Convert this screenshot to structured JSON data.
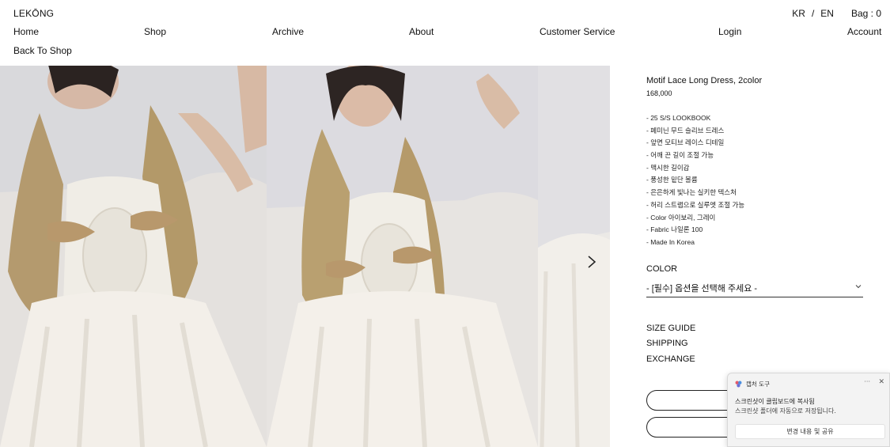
{
  "header": {
    "brand": "LEKŌNG",
    "lang_kr": "KR",
    "lang_sep": "/",
    "lang_en": "EN",
    "bag": "Bag : 0"
  },
  "nav": {
    "items": [
      "Home",
      "Shop",
      "Archive",
      "About",
      "Customer Service",
      "Login",
      "Account"
    ]
  },
  "back_link": "Back To Shop",
  "gallery": {
    "next_icon": "chevron-right-icon"
  },
  "product": {
    "title": "Motif Lace Long Dress, 2color",
    "price": "168,000",
    "description": [
      "- 25 S/S LOOKBOOK",
      "- 페미닌 무드 슬리브 드레스",
      "- 앞면 모티브 레이스 디테일",
      "- 어깨 끈 길이 조절 가능",
      "- 맥시한 길이감",
      "- 풍성한 밑단 볼륨",
      "- 은은하게 빛나는 실키한 텍스처",
      "- 허리 스트랩으로 실루엣 조절 가능",
      "- Color 아이보리, 그레이",
      "- Fabric 나일론 100",
      "- Made In Korea"
    ],
    "color_label": "COLOR",
    "color_select": "- [필수] 옵션을 선택해 주세요 -",
    "links": [
      "SIZE GUIDE",
      "SHIPPING",
      "EXCHANGE"
    ]
  },
  "toast": {
    "app_name": "캡처 도구",
    "more": "···",
    "close": "✕",
    "title": "스크린샷이 클립보드에 복사됨",
    "subtitle": "스크린샷 폴더에 자동으로 저장됩니다.",
    "button": "변경 내용 및 공유"
  }
}
